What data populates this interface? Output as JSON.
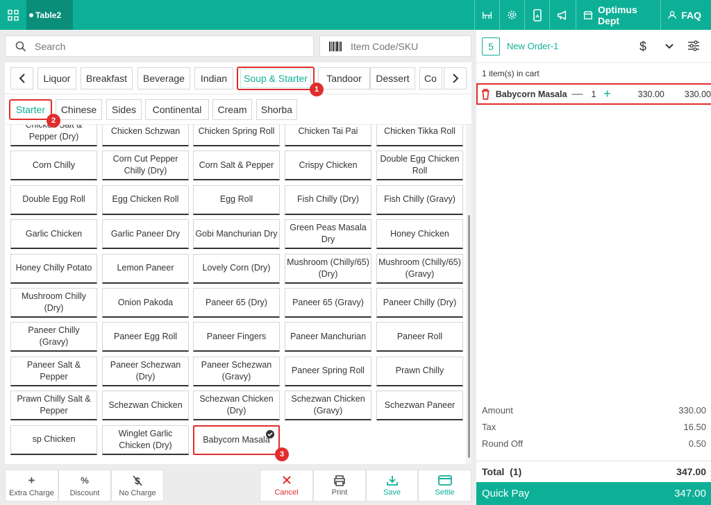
{
  "topbar": {
    "table_tab": "Table2",
    "dept_label": "Optimus Dept",
    "faq_label": "FAQ"
  },
  "search": {
    "placeholder": "Search"
  },
  "itemcode": {
    "placeholder": "Item Code/SKU"
  },
  "categories": [
    "Liquor",
    "Breakfast",
    "Beverage",
    "Indian",
    "Soup & Starter",
    "Tandoor",
    "Dessert",
    "Co"
  ],
  "active_category": "Soup & Starter",
  "subcategories": [
    "Starter",
    "Chinese",
    "Sides",
    "Continental",
    "Cream",
    "Shorba"
  ],
  "active_subcategory": "Starter",
  "items": [
    "Chicken Salt & Pepper (Dry)",
    "Chicken Schzwan",
    "Chicken Spring Roll",
    "Chicken Tai Pai",
    "Chicken Tikka Roll",
    "Corn Chilly",
    "Corn Cut Pepper Chilly (Dry)",
    "Corn Salt & Pepper",
    "Crispy Chicken",
    "Double Egg Chicken Roll",
    "Double Egg Roll",
    "Egg Chicken Roll",
    "Egg Roll",
    "Fish Chilly (Dry)",
    "Fish Chilly (Gravy)",
    "Garlic Chicken",
    "Garlic Paneer Dry",
    "Gobi Manchurian Dry",
    "Green Peas Masala Dry",
    "Honey Chicken",
    "Honey Chilly Potato",
    "Lemon Paneer",
    "Lovely Corn (Dry)",
    "Mushroom (Chilly/65) (Dry)",
    "Mushroom (Chilly/65) (Gravy)",
    "Mushroom Chilly (Dry)",
    "Onion Pakoda",
    "Paneer 65 (Dry)",
    "Paneer 65 (Gravy)",
    "Paneer Chilly (Dry)",
    "Paneer Chilly (Gravy)",
    "Paneer Egg Roll",
    "Paneer Fingers",
    "Paneer Manchurian",
    "Paneer Roll",
    "Paneer Salt & Pepper",
    "Paneer Schezwan (Dry)",
    "Paneer Schezwan (Gravy)",
    "Paneer Spring Roll",
    "Prawn Chilly",
    "Prawn Chilly Salt & Pepper",
    "Schezwan Chicken",
    "Schezwan Chicken (Dry)",
    "Schezwan Chicken (Gravy)",
    "Schezwan Paneer",
    "sp Chicken",
    "Winglet Garlic Chicken (Dry)",
    "Babycorn Masala"
  ],
  "selected_item": "Babycorn Masala",
  "step_badges": [
    "1",
    "2",
    "3"
  ],
  "bottom_actions": {
    "extra_charge": "Extra Charge",
    "discount": "Discount",
    "no_charge": "No Charge",
    "cancel": "Cancel",
    "print": "Print",
    "save": "Save",
    "settle": "Settle"
  },
  "order": {
    "number": "5",
    "name": "New Order-1",
    "cart_count": "1 item(s) in cart",
    "cart_items": [
      {
        "name": "Babycorn Masala",
        "qty": "1",
        "price": "330.00",
        "total": "330.00"
      }
    ]
  },
  "totals": {
    "amount_label": "Amount",
    "amount": "330.00",
    "tax_label": "Tax",
    "tax": "16.50",
    "roundoff_label": "Round Off",
    "roundoff": "0.50",
    "total_label": "Total  (1)",
    "total": "347.00",
    "quickpay_label": "Quick Pay",
    "quickpay": "347.00"
  },
  "colors": {
    "brand": "#0db097",
    "brand_dark": "#0a8e7a",
    "annotation_red": "#e02d2d",
    "cancel_red": "#e02d2d"
  }
}
